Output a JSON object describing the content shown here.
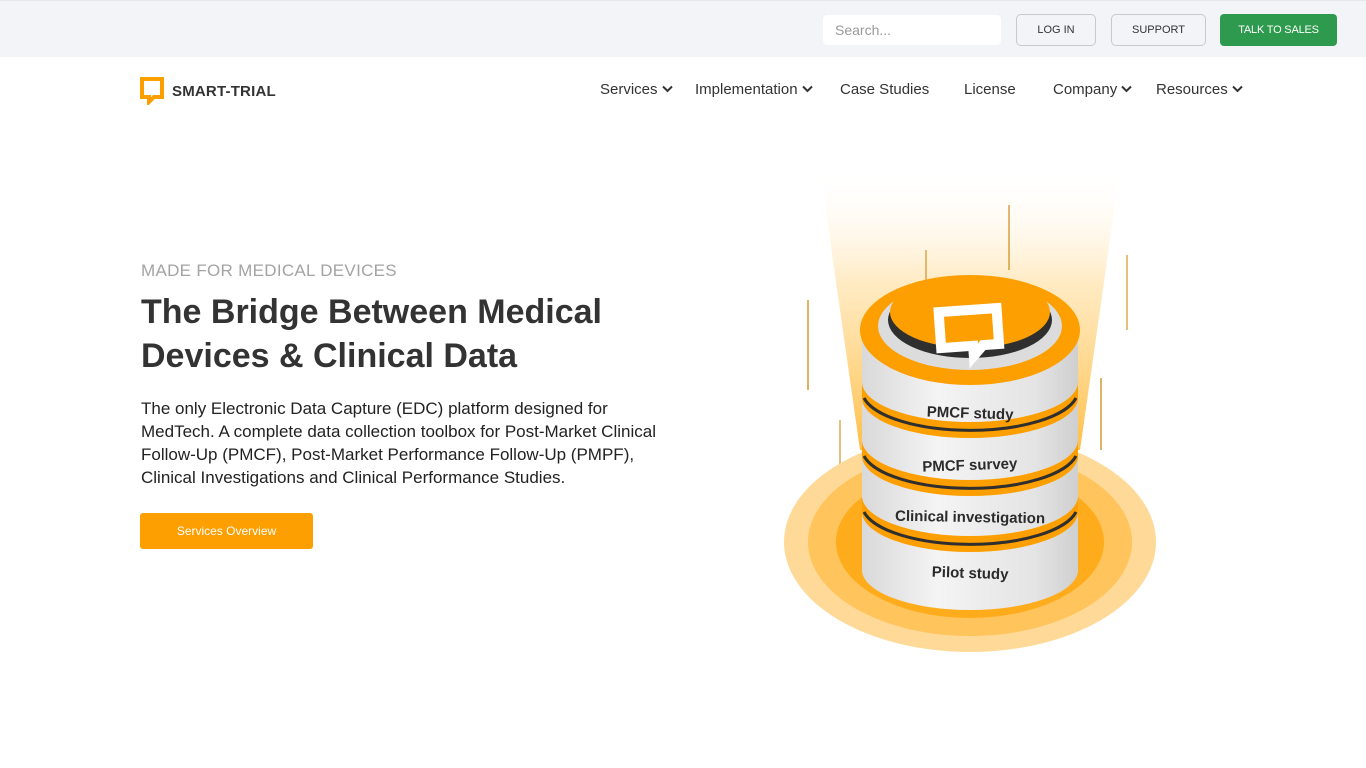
{
  "utility": {
    "search_placeholder": "Search...",
    "login_label": "LOG IN",
    "support_label": "SUPPORT",
    "sales_label": "TALK TO SALES"
  },
  "brand": {
    "name": "SMART-TRIAL",
    "accent_color": "#fd9f00",
    "green_color": "#2e9a4e"
  },
  "nav": {
    "items": [
      {
        "label": "Services",
        "dropdown": true
      },
      {
        "label": "Implementation",
        "dropdown": true
      },
      {
        "label": "Case Studies",
        "dropdown": false
      },
      {
        "label": "License",
        "dropdown": false
      },
      {
        "label": "Company",
        "dropdown": true
      },
      {
        "label": "Resources",
        "dropdown": true
      }
    ]
  },
  "hero": {
    "eyebrow": "MADE FOR MEDICAL DEVICES",
    "headline": "The Bridge Between Medical Devices & Clinical Data",
    "description": "The only Electronic Data Capture (EDC) platform designed for MedTech. A complete data collection toolbox for Post-Market Clinical Follow-Up (PMCF), Post-Market Performance Follow-Up (PMPF), Clinical Investigations and Clinical Performance Studies.",
    "cta_label": "Services Overview"
  },
  "illustration": {
    "layers": [
      "PMCF study",
      "PMCF survey",
      "Clinical investigation",
      "Pilot study"
    ]
  }
}
